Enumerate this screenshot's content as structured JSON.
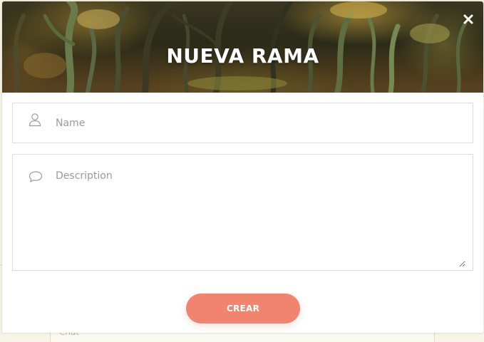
{
  "background": {
    "chat_label": "Chat"
  },
  "modal": {
    "title": "NUEVA RAMA",
    "close_icon": "close-icon",
    "name_field": {
      "icon": "user-icon",
      "placeholder": "Name",
      "value": ""
    },
    "description_field": {
      "icon": "speech-bubble-icon",
      "placeholder": "Description",
      "value": ""
    },
    "submit_label": "CREAR"
  },
  "colors": {
    "accent": "#f0846f",
    "page_background": "#f6f5e6",
    "field_border": "#dcdcdc"
  }
}
